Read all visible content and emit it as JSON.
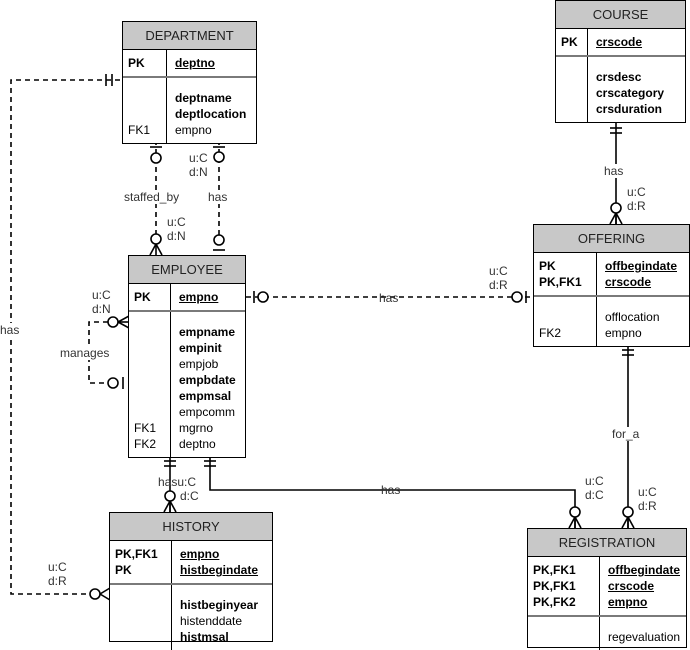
{
  "entities": {
    "department": {
      "title": "DEPARTMENT",
      "pk": [
        {
          "key": "PK",
          "name": "deptno"
        }
      ],
      "attrs": [
        {
          "key": "",
          "name": "deptname",
          "bold": true
        },
        {
          "key": "",
          "name": "deptlocation",
          "bold": true
        },
        {
          "key": "FK1",
          "name": "empno",
          "bold": false
        }
      ]
    },
    "course": {
      "title": "COURSE",
      "pk": [
        {
          "key": "PK",
          "name": "crscode"
        }
      ],
      "attrs": [
        {
          "key": "",
          "name": "crsdesc",
          "bold": true
        },
        {
          "key": "",
          "name": "crscategory",
          "bold": true
        },
        {
          "key": "",
          "name": "crsduration",
          "bold": true
        }
      ]
    },
    "employee": {
      "title": "EMPLOYEE",
      "pk": [
        {
          "key": "PK",
          "name": "empno"
        }
      ],
      "attrs": [
        {
          "key": "",
          "name": "empname",
          "bold": true
        },
        {
          "key": "",
          "name": "empinit",
          "bold": true
        },
        {
          "key": "",
          "name": "empjob",
          "bold": false
        },
        {
          "key": "",
          "name": "empbdate",
          "bold": true
        },
        {
          "key": "",
          "name": "empmsal",
          "bold": true
        },
        {
          "key": "",
          "name": "empcomm",
          "bold": false
        },
        {
          "key": "FK1",
          "name": "mgrno",
          "bold": false
        },
        {
          "key": "FK2",
          "name": "deptno",
          "bold": false
        }
      ]
    },
    "offering": {
      "title": "OFFERING",
      "pk": [
        {
          "key": "PK",
          "name": "offbegindate"
        },
        {
          "key": "PK,FK1",
          "name": "crscode"
        }
      ],
      "attrs": [
        {
          "key": "",
          "name": "offlocation",
          "bold": false
        },
        {
          "key": "FK2",
          "name": "empno",
          "bold": false
        }
      ]
    },
    "history": {
      "title": "HISTORY",
      "pk": [
        {
          "key": "PK,FK1",
          "name": "empno"
        },
        {
          "key": "PK",
          "name": "histbegindate"
        }
      ],
      "attrs": [
        {
          "key": "",
          "name": "histbeginyear",
          "bold": true
        },
        {
          "key": "",
          "name": "histenddate",
          "bold": false
        },
        {
          "key": "",
          "name": "histmsal",
          "bold": true
        }
      ]
    },
    "registration": {
      "title": "REGISTRATION",
      "pk": [
        {
          "key": "PK,FK1",
          "name": "offbegindate"
        },
        {
          "key": "PK,FK1",
          "name": "crscode"
        },
        {
          "key": "PK,FK2",
          "name": "empno"
        }
      ],
      "attrs": [
        {
          "key": "",
          "name": "regevaluation",
          "bold": false
        }
      ]
    }
  },
  "relationships": [
    {
      "id": "dept-staffed_by-emp",
      "label": "staffed_by",
      "constraint_upper": "",
      "constraint_lower": "u:C d:N"
    },
    {
      "id": "dept-has-emp",
      "label": "has",
      "constraint_upper": "u:C d:N"
    },
    {
      "id": "dept-has-history",
      "label": "has",
      "constraint": "u:C d:R"
    },
    {
      "id": "emp-manages-emp",
      "label": "manages",
      "constraint": "u:C d:N"
    },
    {
      "id": "emp-has-offering",
      "label": "has",
      "constraint": "u:C d:R"
    },
    {
      "id": "course-has-offering",
      "label": "has",
      "constraint": "u:C d:R"
    },
    {
      "id": "emp-has-history",
      "label": "has",
      "constraint": "u:C d:C"
    },
    {
      "id": "emp-has-registration",
      "label": "has",
      "constraint": "u:C d:C"
    },
    {
      "id": "offering-for_a-registration",
      "label": "for_a",
      "constraint": "u:C d:R"
    }
  ],
  "labels": {
    "staffed_by": "staffed_by",
    "has": "has",
    "manages": "manages",
    "for_a": "for_a",
    "hasu": "hasu:C",
    "uC": "u:C",
    "dN": "d:N",
    "dR": "d:R",
    "dC": "d:C"
  }
}
